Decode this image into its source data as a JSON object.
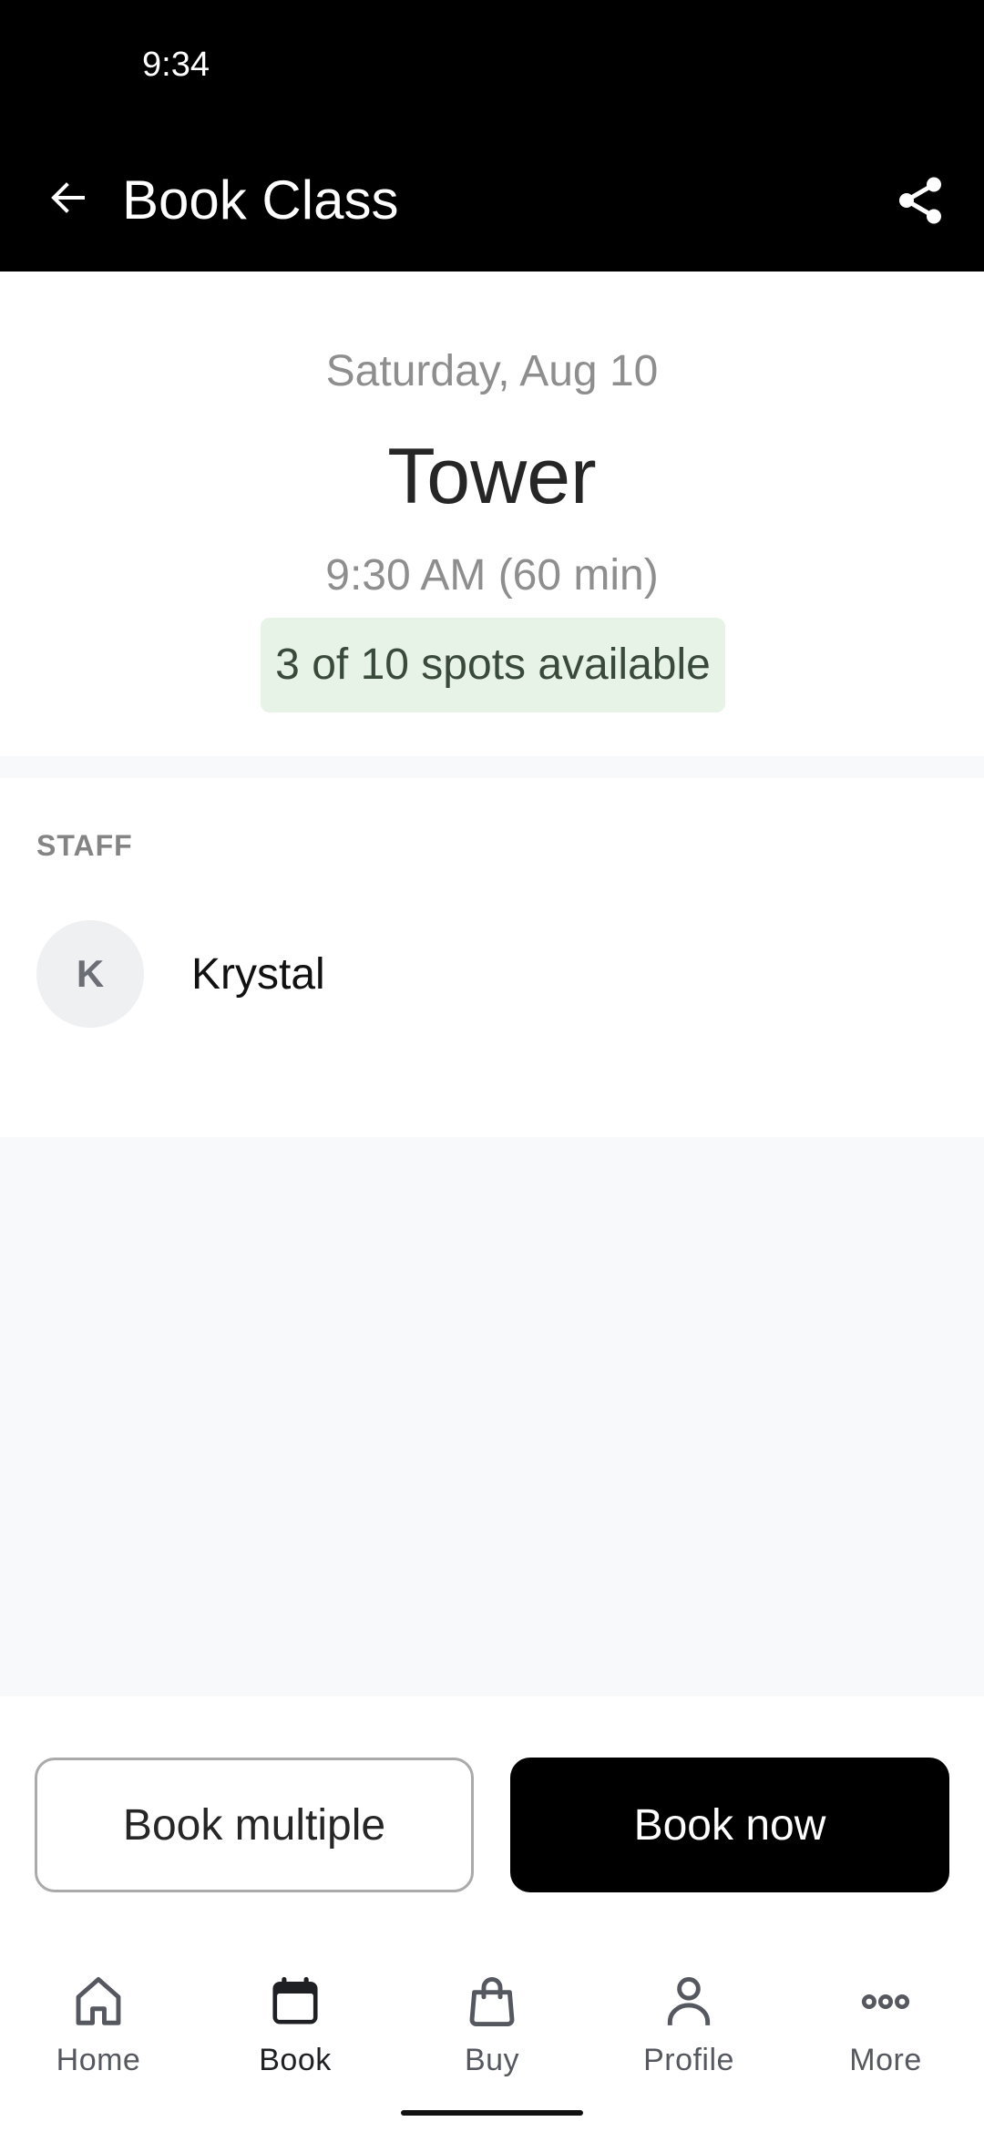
{
  "status_bar": {
    "time": "9:34"
  },
  "app_bar": {
    "title": "Book Class",
    "back_icon": "arrow-left-icon",
    "share_icon": "share-icon"
  },
  "class_info": {
    "date": "Saturday, Aug 10",
    "name": "Tower",
    "time": "9:30 AM (60 min)",
    "spots": "3 of 10 spots available",
    "spots_available": 3,
    "spots_total": 10
  },
  "staff": {
    "heading": "STAFF",
    "members": [
      {
        "initial": "K",
        "name": "Krystal"
      }
    ]
  },
  "actions": {
    "book_multiple": "Book multiple",
    "book_now": "Book now"
  },
  "bottom_nav": {
    "items": [
      {
        "label": "Home",
        "icon": "home-icon",
        "active": false
      },
      {
        "label": "Book",
        "icon": "calendar-icon",
        "active": true
      },
      {
        "label": "Buy",
        "icon": "shopping-bag-icon",
        "active": false
      },
      {
        "label": "Profile",
        "icon": "person-icon",
        "active": false
      },
      {
        "label": "More",
        "icon": "more-dots-icon",
        "active": false
      }
    ]
  },
  "colors": {
    "header_bg": "#000000",
    "badge_bg": "#e6f3e6",
    "primary_button": "#000000",
    "page_bg": "#f8f9fb"
  }
}
